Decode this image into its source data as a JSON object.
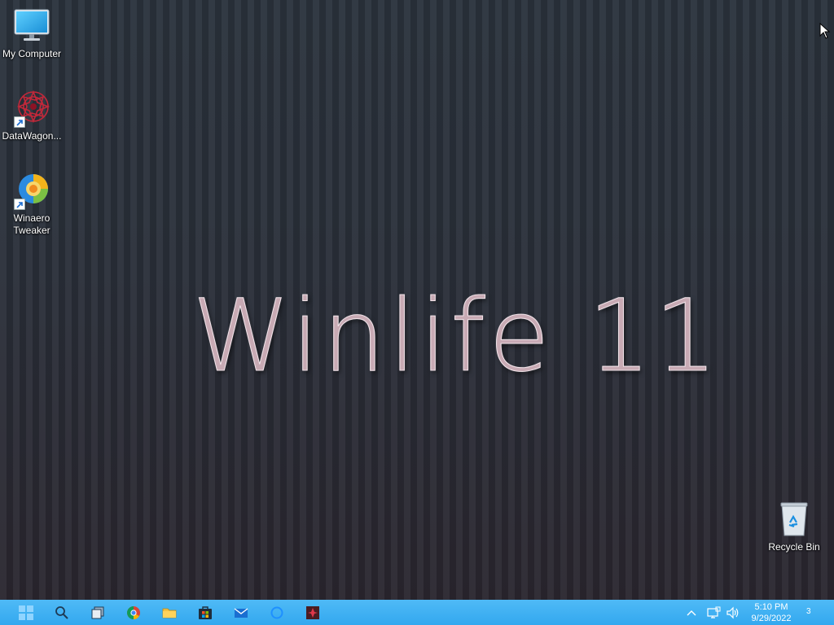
{
  "wallpaper": {
    "text": "Winlife 11"
  },
  "desktop_icons": [
    {
      "label": "My Computer",
      "icon": "monitor-icon"
    },
    {
      "label": "DataWagon...",
      "icon": "datawagon-app-icon",
      "shortcut": true
    },
    {
      "label": "Winaero\nTweaker",
      "icon": "winaero-tweaker-icon",
      "shortcut": true
    },
    {
      "label": "Recycle Bin",
      "icon": "recycle-bin-icon"
    }
  ],
  "taskbar": {
    "pinned": [
      {
        "name": "start",
        "icon": "windows-start-icon"
      },
      {
        "name": "search",
        "icon": "search-icon"
      },
      {
        "name": "task-view",
        "icon": "task-view-icon"
      },
      {
        "name": "chrome",
        "icon": "chrome-icon"
      },
      {
        "name": "file-explorer",
        "icon": "folder-icon"
      },
      {
        "name": "store",
        "icon": "store-icon"
      },
      {
        "name": "mail",
        "icon": "mail-icon"
      },
      {
        "name": "cortana",
        "icon": "cortana-icon"
      },
      {
        "name": "datawagon",
        "icon": "datawagon-app-icon"
      }
    ],
    "tray": {
      "icons": [
        "chevron-up-icon",
        "network-icon",
        "volume-icon"
      ],
      "time": "5:10 PM",
      "date": "9/29/2022",
      "notification_count": "3"
    }
  },
  "colors": {
    "taskbar": "#3cb0f4",
    "desktop_bg": "#2a3039",
    "wallpaper_text": "#c8aab4"
  }
}
